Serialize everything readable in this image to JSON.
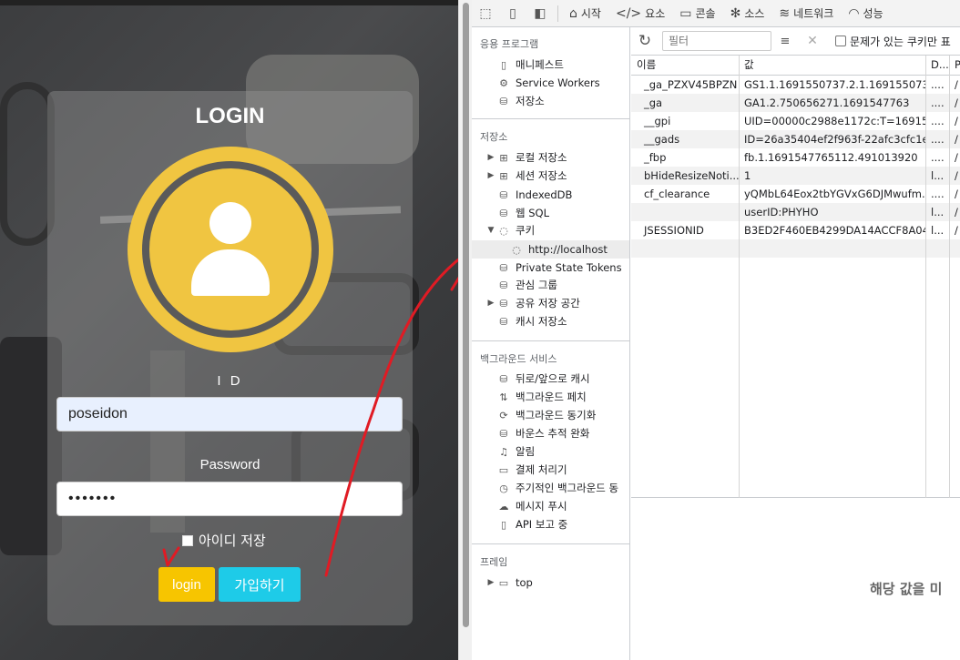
{
  "login": {
    "title": "LOGIN",
    "id_label": "I D",
    "id_value": "poseidon",
    "password_label": "Password",
    "password_value": "•••••••",
    "remember_label": "아이디 저장",
    "login_button": "login",
    "join_button": "가입하기",
    "colors": {
      "accent_yellow": "#f0c541",
      "login_btn": "#f7c500",
      "join_btn": "#1ecbe8",
      "annotation": "#e01b24"
    }
  },
  "devtools": {
    "tabs": [
      {
        "label": "시작",
        "icon": "home-icon"
      },
      {
        "label": "요소",
        "icon": "code-icon"
      },
      {
        "label": "콘솔",
        "icon": "console-icon"
      },
      {
        "label": "소스",
        "icon": "bug-icon"
      },
      {
        "label": "네트워크",
        "icon": "wifi-icon"
      },
      {
        "label": "성능",
        "icon": "gauge-icon"
      }
    ],
    "sidebar": {
      "app_section": "응용 프로그램",
      "app_items": [
        "매니페스트",
        "Service Workers",
        "저장소"
      ],
      "storage_section": "저장소",
      "storage_items": [
        "로컬 저장소",
        "세션 저장소",
        "IndexedDB",
        "웹 SQL",
        "쿠키",
        "http://localhost",
        "Private State Tokens",
        "관심 그룹",
        "공유 저장 공간",
        "캐시 저장소"
      ],
      "bg_section": "백그라운드 서비스",
      "bg_items": [
        "뒤로/앞으로 캐시",
        "백그라운드 페치",
        "백그라운드 동기화",
        "바운스 추적 완화",
        "알림",
        "결제 처리기",
        "주기적인 백그라운드 동",
        "메시지 푸시",
        "API 보고 중"
      ],
      "frames_section": "프레임",
      "frames_items": [
        "top"
      ]
    },
    "cookie_toolbar": {
      "filter_placeholder": "필터",
      "only_issues_label": "문제가 있는 쿠키만 표"
    },
    "table": {
      "headers": [
        "이름",
        "값",
        "D...",
        "P"
      ],
      "rows": [
        [
          "_ga_PZXV45BPZN",
          "GS1.1.1691550737.2.1.1691550739....",
          "....",
          "/"
        ],
        [
          "_ga",
          "GA1.2.750656271.1691547763",
          "....",
          "/"
        ],
        [
          "__gpi",
          "UID=00000c2988e1172c:T=169154...",
          "....",
          "/"
        ],
        [
          "__gads",
          "ID=26a35404ef2f963f-22afc3cfc1e2...",
          "....",
          "/"
        ],
        [
          "_fbp",
          "fb.1.1691547765112.491013920",
          "....",
          "/"
        ],
        [
          "bHideResizeNoti...",
          "1",
          "l...",
          "/"
        ],
        [
          "cf_clearance",
          "yQMbL64Eox2tbYGVxG6DJMwufm...",
          "....",
          "/"
        ],
        [
          "",
          "userID:PHYHO",
          "l...",
          "/"
        ],
        [
          "JSESSIONID",
          "B3ED2F460EB4299DA14ACCF8A044...",
          "l...",
          "/"
        ]
      ]
    },
    "preview_text": "해당 값을 미"
  }
}
